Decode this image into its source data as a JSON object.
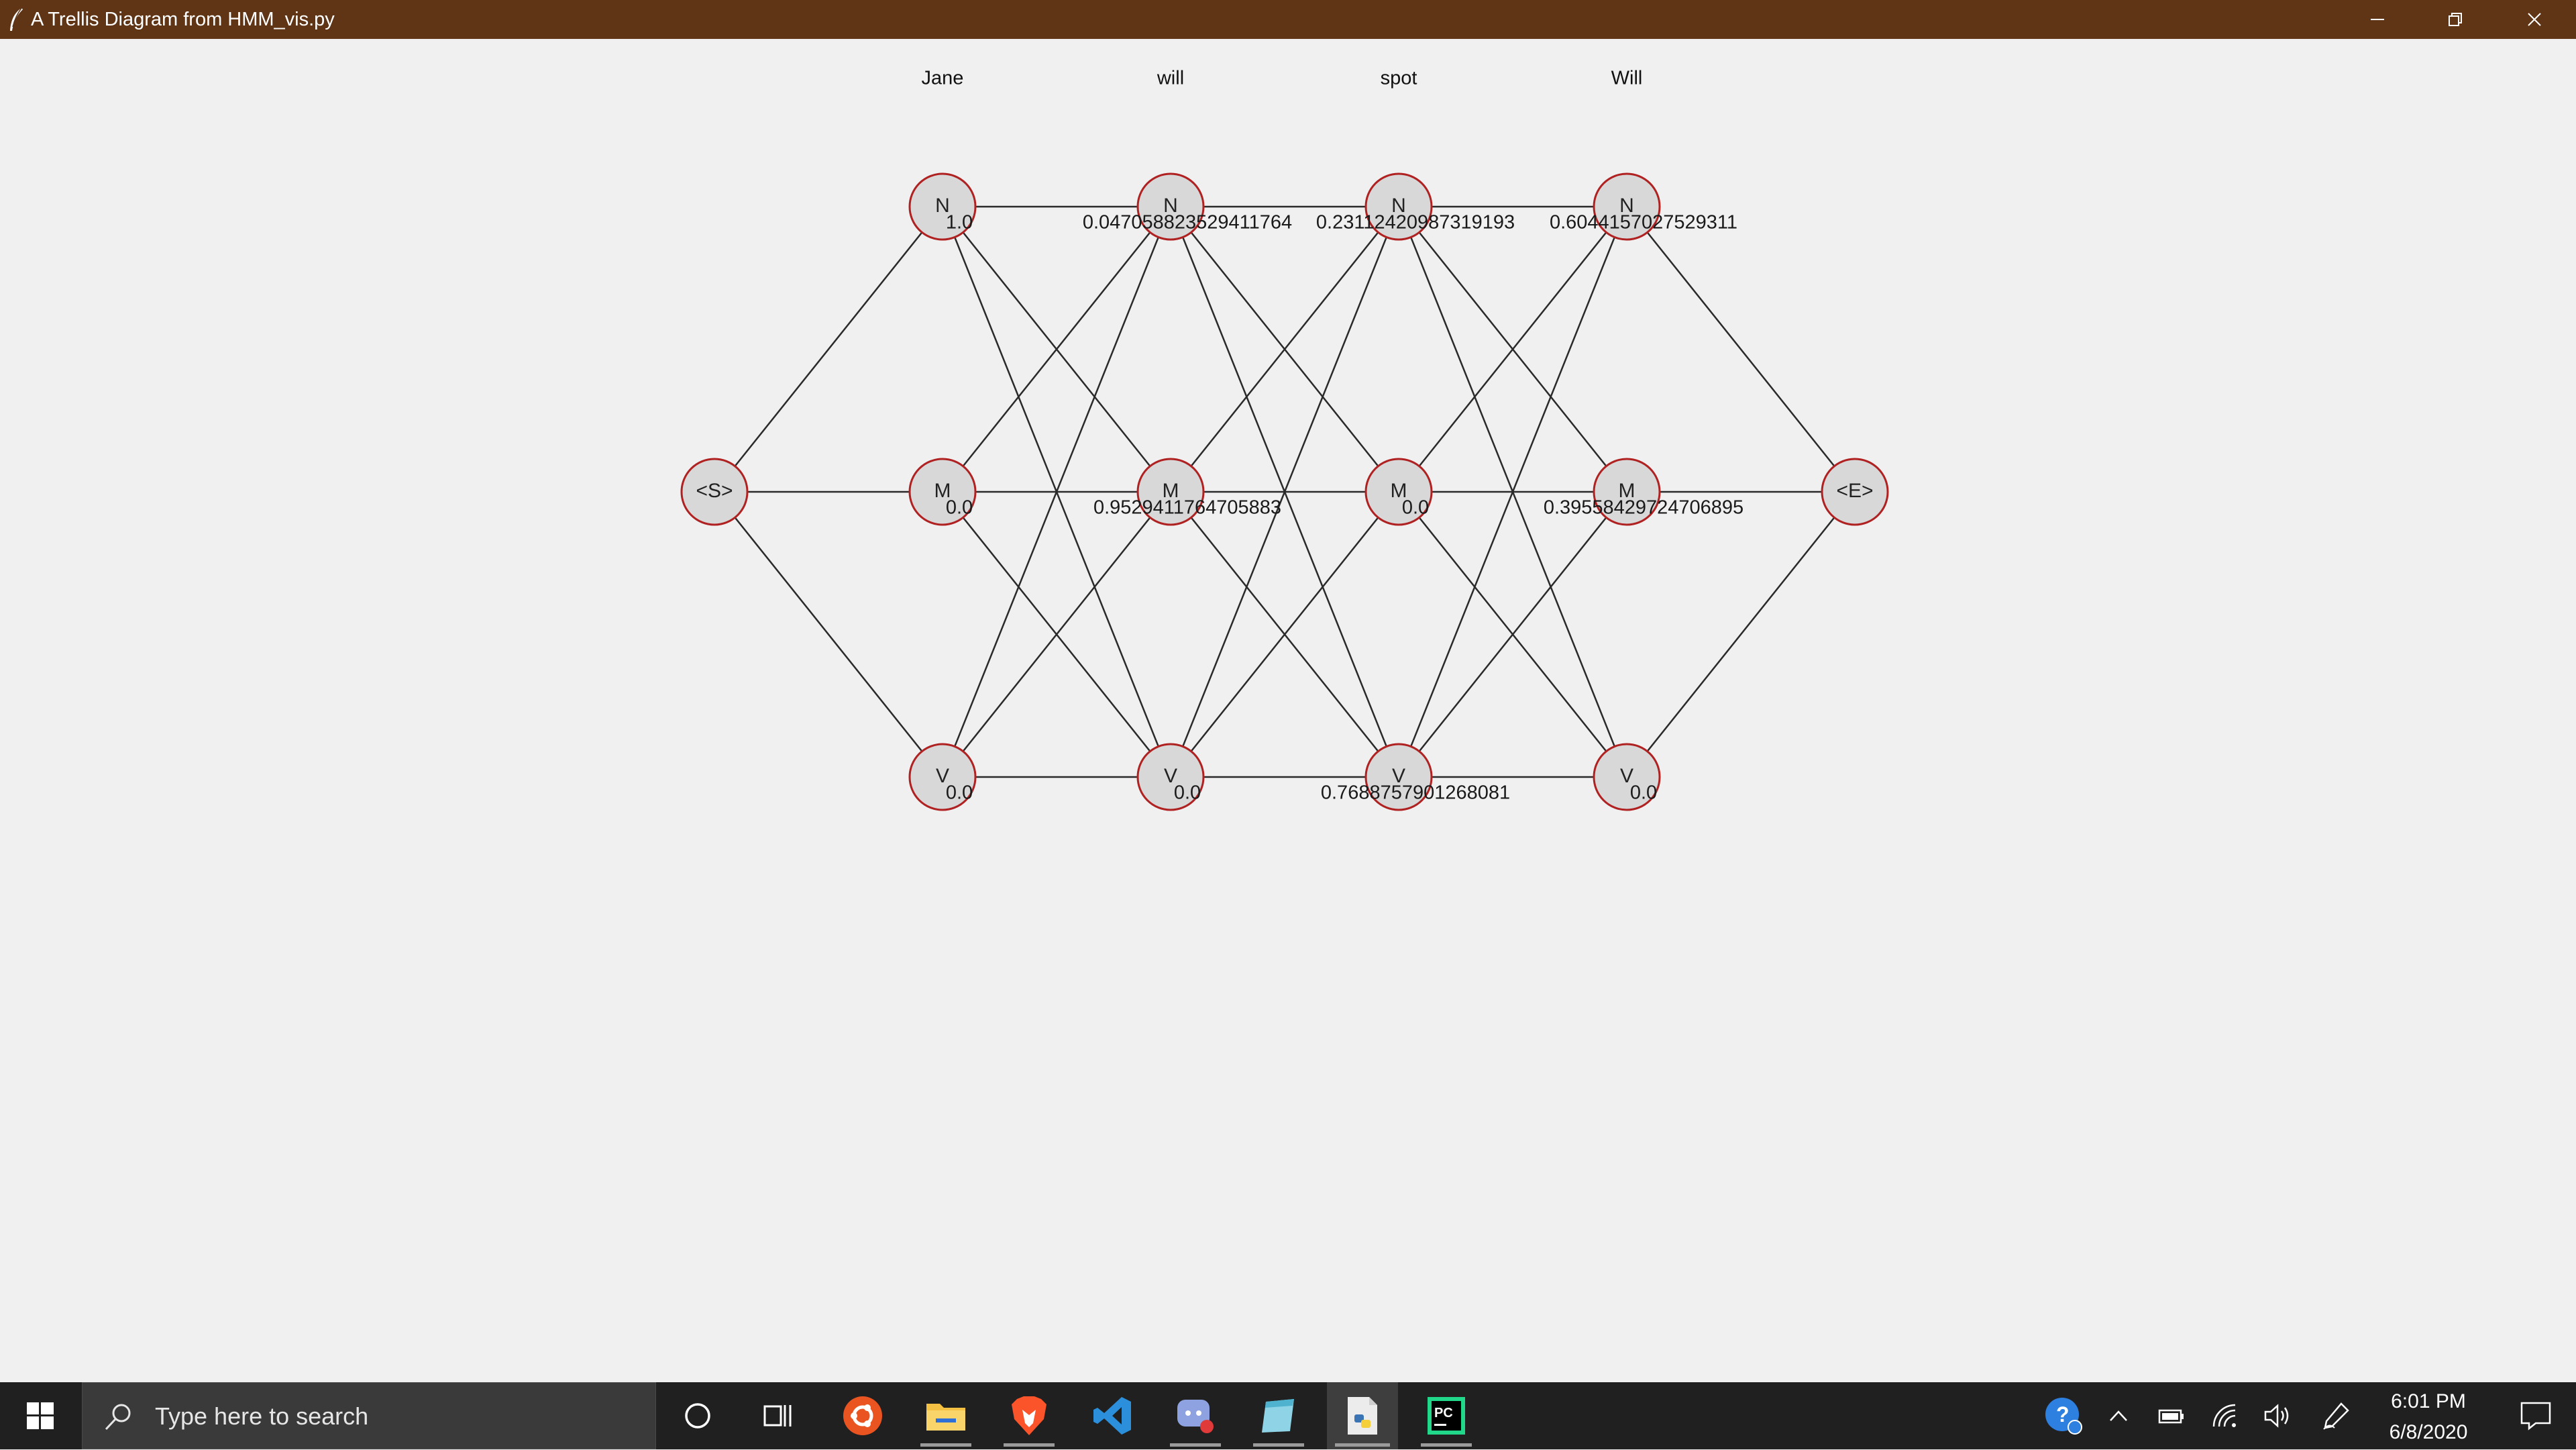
{
  "window": {
    "title": "A Trellis Diagram from HMM_vis.py"
  },
  "trellis": {
    "words": [
      "Jane",
      "will",
      "spot",
      "Will"
    ],
    "start_label": "<S>",
    "end_label": "<E>",
    "states": [
      "N",
      "M",
      "V"
    ],
    "probabilities": {
      "N": [
        "1.0",
        "0.047058823529411764",
        "0.23112420987319193",
        "0.6044157027529311"
      ],
      "M": [
        "0.0",
        "0.9529411764705883",
        "0.0",
        "0.39558429724706895"
      ],
      "V": [
        "0.0",
        "0.0",
        "0.7688757901268081",
        "0.0"
      ]
    }
  },
  "taskbar": {
    "search_placeholder": "Type here to search",
    "apps": [
      "ubuntu",
      "file-explorer",
      "brave",
      "vscode",
      "discord",
      "notepad",
      "python-idle",
      "pycharm"
    ],
    "time": "6:01 PM",
    "date": "6/8/2020"
  }
}
